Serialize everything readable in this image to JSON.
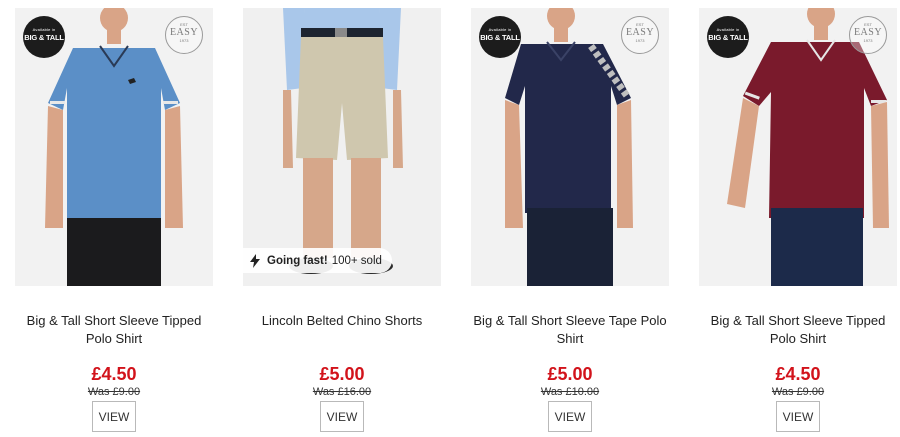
{
  "products": [
    {
      "title": "Big & Tall Short Sleeve Tipped Polo Shirt",
      "price": "£4.50",
      "was": "Was £9.00",
      "view_label": "VIEW",
      "badge_big_small": "Available in",
      "badge_big_main": "BIG & TALL",
      "badge_easy_top": "EST",
      "badge_easy_word": "EASY",
      "badge_easy_year": "1973",
      "shirt_color": "#5b8fc7",
      "leg_color": "#1b1b1d"
    },
    {
      "title": "Lincoln Belted Chino Shorts",
      "price": "£5.00",
      "was": "Was £16.00",
      "view_label": "VIEW",
      "fast_bold": "Going fast!",
      "fast_text": "100+ sold",
      "shorts_color": "#cfc7ae",
      "shirt_color": "#a9c7ea"
    },
    {
      "title": "Big & Tall Short Sleeve Tape Polo Shirt",
      "price": "£5.00",
      "was": "Was £10.00",
      "view_label": "VIEW",
      "badge_big_small": "Available in",
      "badge_big_main": "BIG & TALL",
      "badge_easy_top": "EST",
      "badge_easy_word": "EASY",
      "badge_easy_year": "1973",
      "shirt_color": "#22284a",
      "leg_color": "#1a2236"
    },
    {
      "title": "Big & Tall Short Sleeve Tipped Polo Shirt",
      "price": "£4.50",
      "was": "Was £9.00",
      "view_label": "VIEW",
      "badge_big_small": "Available in",
      "badge_big_main": "BIG & TALL",
      "badge_easy_top": "EST",
      "badge_easy_word": "EASY",
      "badge_easy_year": "1973",
      "shirt_color": "#7a1a2c",
      "leg_color": "#1c2a4a"
    }
  ],
  "colors": {
    "price": "#d2131b",
    "skin": "#d9a487",
    "hair": "#4a3222"
  }
}
